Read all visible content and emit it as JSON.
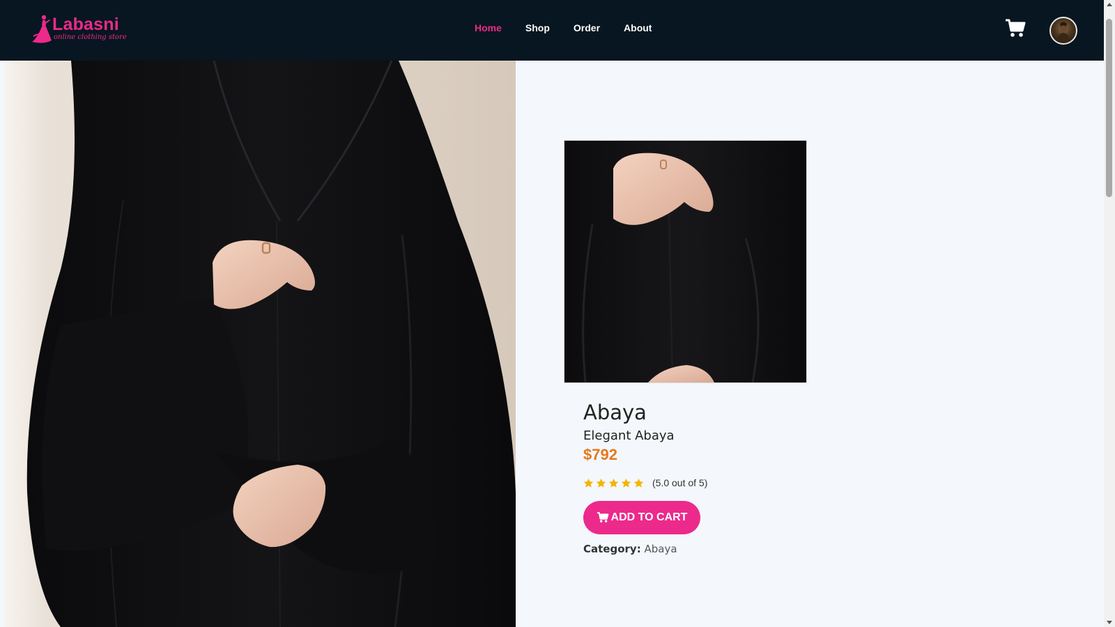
{
  "brand": {
    "name": "Labasni",
    "tagline": "online clothing store",
    "accent_color": "#ec2a8b"
  },
  "nav": {
    "items": [
      {
        "label": "Home",
        "active": true
      },
      {
        "label": "Shop",
        "active": false
      },
      {
        "label": "Order",
        "active": false
      },
      {
        "label": "About",
        "active": false
      }
    ],
    "cart_icon": "shopping-cart-icon",
    "avatar_icon": "user-avatar"
  },
  "product": {
    "name": "Abaya",
    "subtitle": "Elegant Abaya",
    "price": "$792",
    "price_color": "#e5791e",
    "rating": 5,
    "rating_max": 5,
    "rating_text": "(5.0 out of 5)",
    "add_to_cart_label": "ADD TO CART",
    "category_label": "Category:",
    "category_value": "Abaya"
  }
}
